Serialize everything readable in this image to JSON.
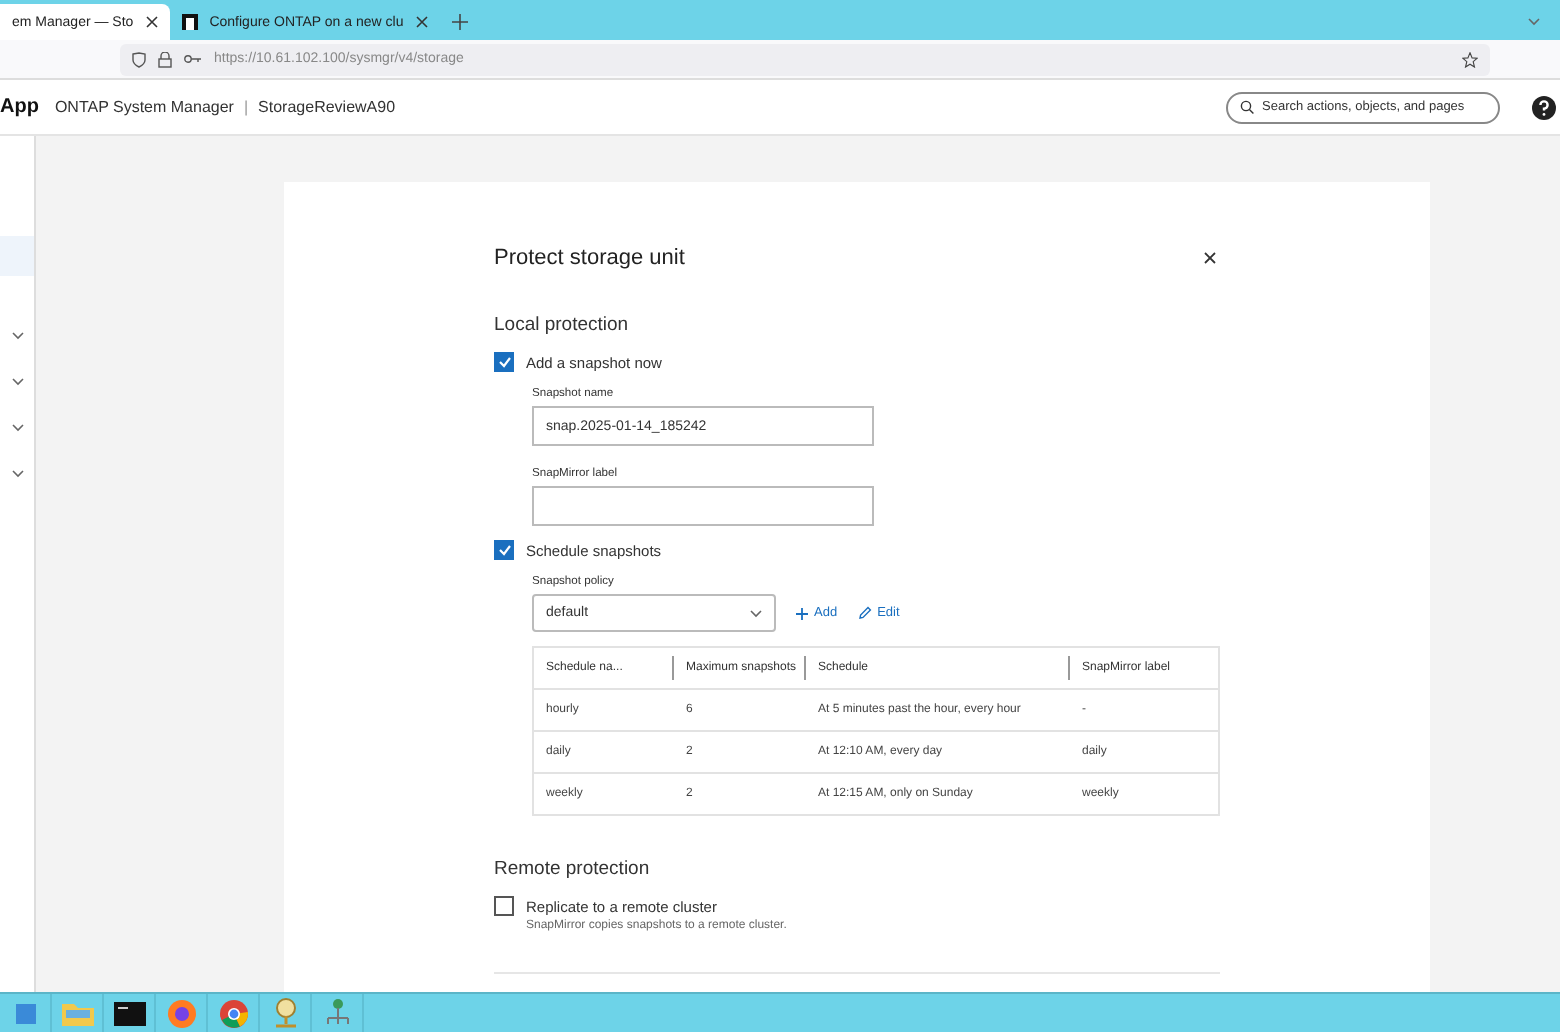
{
  "browser": {
    "tabs": [
      {
        "label": "em Manager — Sto",
        "selected": true
      },
      {
        "label": "Configure ONTAP on a new clu",
        "selected": false
      }
    ],
    "url": "https://10.61.102.100/sysmgr/v4/storage"
  },
  "header": {
    "logo": "App",
    "product": "ONTAP System Manager",
    "separator": "|",
    "cluster": "StorageReviewA90",
    "search": {
      "placeholder": "Search actions, objects, and pages"
    }
  },
  "sidebar": {
    "items": [
      {
        "kind": "plain",
        "selected": true
      },
      {
        "kind": "group",
        "selected": false
      },
      {
        "kind": "group",
        "selected": false
      },
      {
        "kind": "group",
        "selected": false
      },
      {
        "kind": "group",
        "selected": false
      }
    ]
  },
  "dialog": {
    "title": "Protect storage unit",
    "local_protection": {
      "heading": "Local protection",
      "add_snapshot": {
        "label": "Add a snapshot now",
        "checked": true
      },
      "snapshot_name": {
        "label": "Snapshot name",
        "value": "snap.2025-01-14_185242"
      },
      "snapmirror_label": {
        "label": "SnapMirror label"
      },
      "schedule_snapshots": {
        "label": "Schedule snapshots",
        "checked": true
      },
      "snapshot_policy": {
        "label": "Snapshot policy",
        "value": "default"
      },
      "actions": [
        {
          "kind": "add",
          "label": "Add"
        },
        {
          "kind": "edit",
          "label": "Edit"
        }
      ],
      "table": {
        "columns": [
          "Schedule na...",
          "Maximum snapshots",
          "Schedule",
          "SnapMirror label"
        ],
        "rows": [
          [
            "hourly",
            "6",
            "At 5 minutes past the hour, every hour",
            "-"
          ],
          [
            "daily",
            "2",
            "At 12:10 AM, every day",
            "daily"
          ],
          [
            "weekly",
            "2",
            "At 12:15 AM, only on Sunday",
            "weekly"
          ]
        ]
      }
    },
    "remote_protection": {
      "heading": "Remote protection",
      "replicate": {
        "label": "Replicate to a remote cluster",
        "checked": false,
        "description": "SnapMirror copies snapshots to a remote cluster."
      }
    }
  },
  "taskbar": {
    "apps": [
      {
        "kind": "windows"
      },
      {
        "kind": "folder"
      },
      {
        "kind": "terminal"
      },
      {
        "kind": "firefox"
      },
      {
        "kind": "chrome"
      },
      {
        "kind": "server"
      },
      {
        "kind": "network"
      }
    ]
  }
}
